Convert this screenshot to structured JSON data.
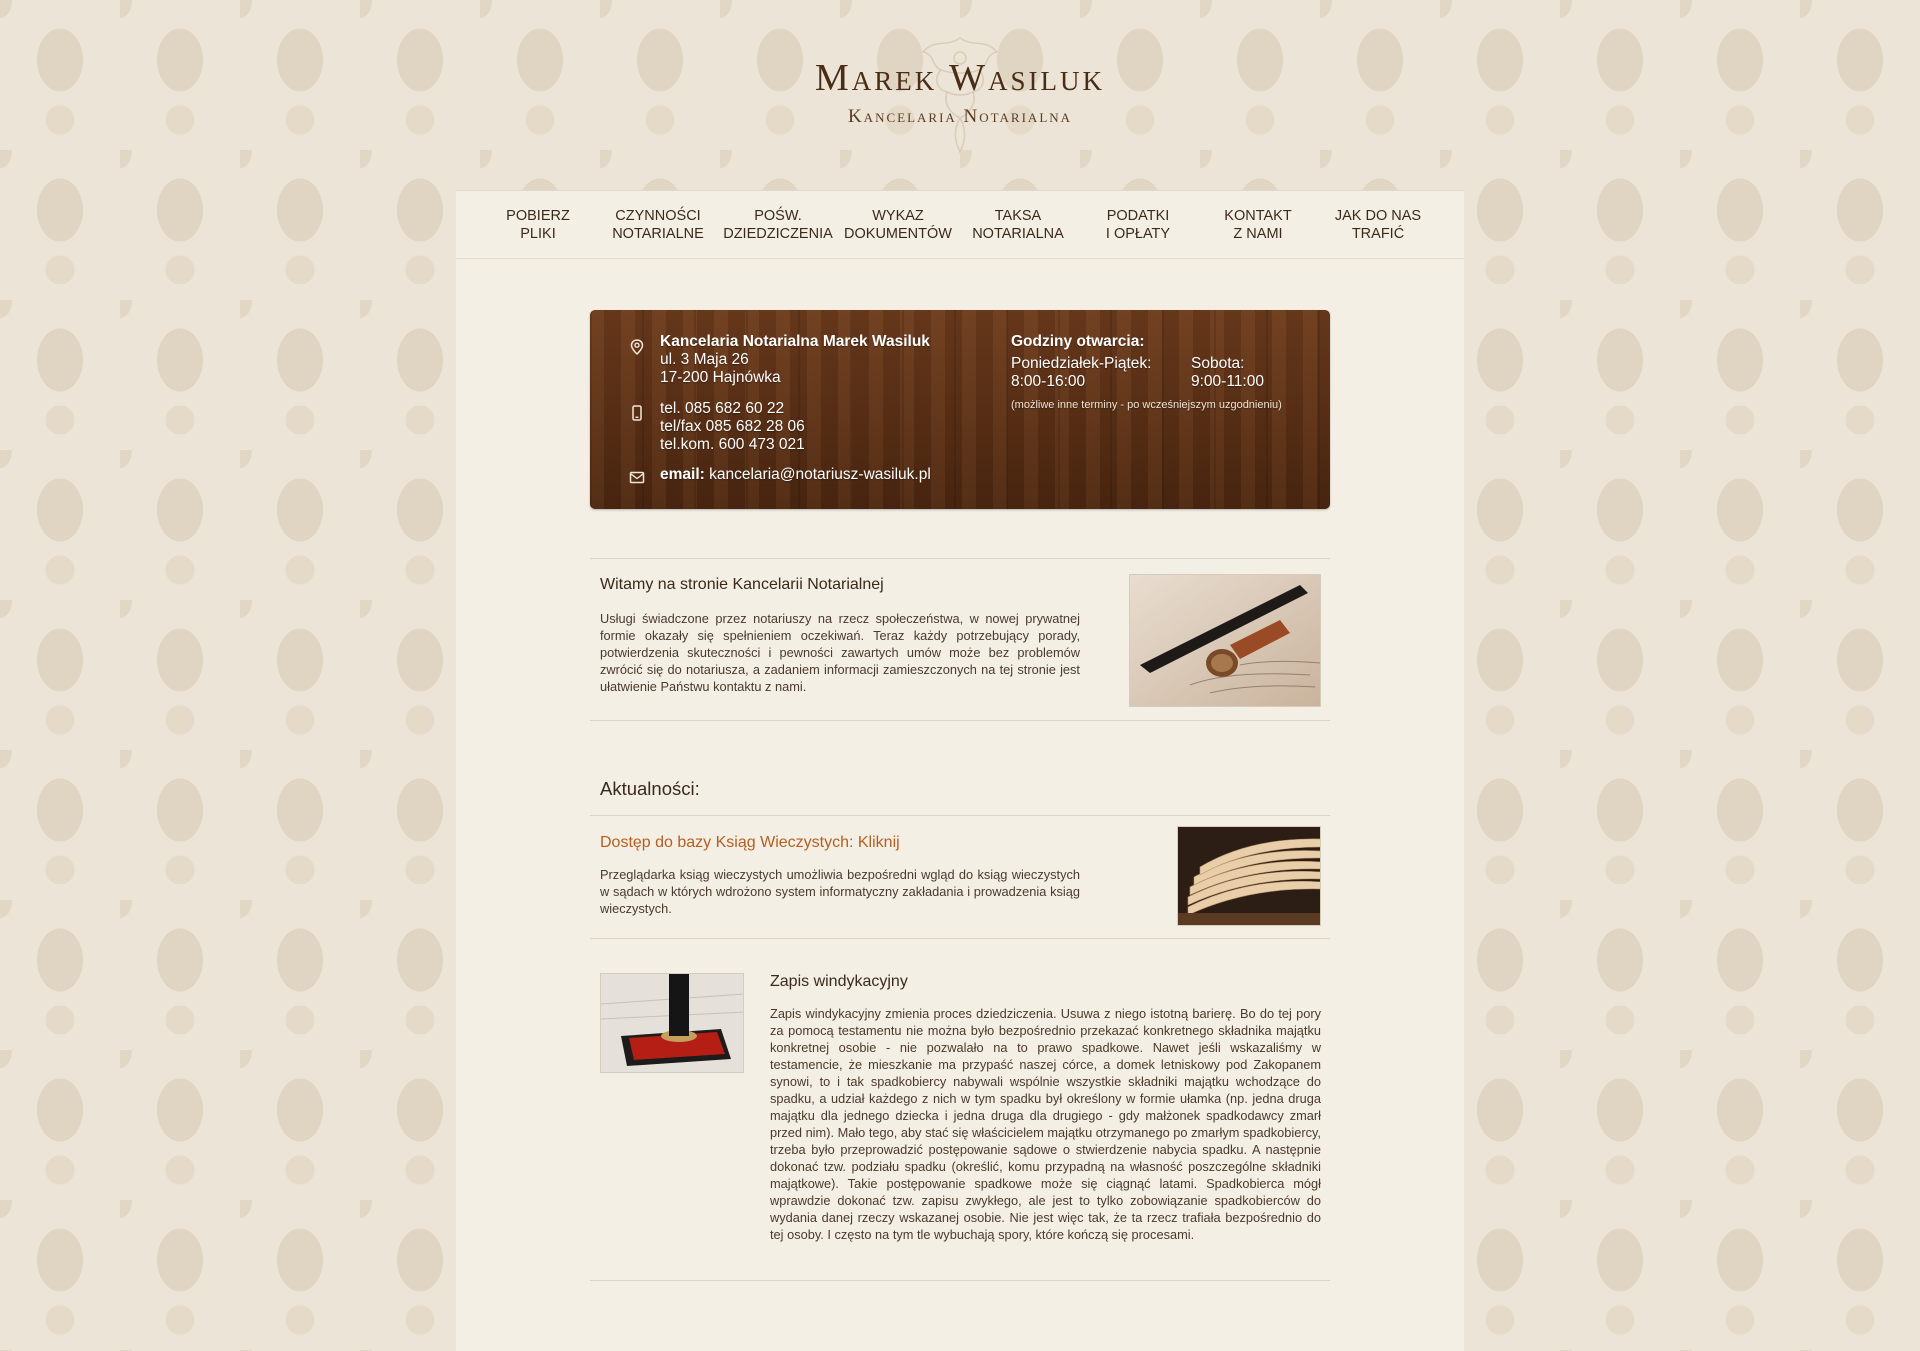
{
  "header": {
    "title": "Marek Wasiluk",
    "subtitle": "Kancelaria Notarialna"
  },
  "nav": {
    "items": [
      {
        "label": "POBIERZ\nPLIKI"
      },
      {
        "label": "CZYNNOŚCI\nNOTARIALNE"
      },
      {
        "label": "POŚW.\nDZIEDZICZENIA"
      },
      {
        "label": "WYKAZ\nDOKUMENTÓW"
      },
      {
        "label": "TAKSA\nNOTARIALNA"
      },
      {
        "label": "PODATKI\nI OPŁATY"
      },
      {
        "label": "KONTAKT\nZ NAMI"
      },
      {
        "label": "JAK DO NAS\nTRAFIĆ"
      }
    ]
  },
  "contact": {
    "office_name": "Kancelaria Notarialna Marek Wasiluk",
    "address": "ul. 3 Maja 26\n17-200 Hajnówka",
    "phones": "tel. 085 682 60 22\ntel/fax 085 682 28 06\ntel.kom. 600 473 021",
    "email_label": "email:",
    "email": "kancelaria@notariusz-wasiluk.pl",
    "hours_title": "Godziny otwarcia:",
    "weekdays_label": "Poniedziałek-Piątek:",
    "weekdays_hours": "8:00-16:00",
    "saturday_label": "Sobota:",
    "saturday_hours": "9:00-11:00",
    "hours_note": "(możliwe inne terminy - po wcześniejszym uzgodnieniu)",
    "icons": [
      "map-pin-icon",
      "phone-icon",
      "mail-icon"
    ]
  },
  "welcome": {
    "title": "Witamy na stronie Kancelarii Notarialnej",
    "text": "Usługi świadczone przez notariuszy na rzecz społeczeństwa, w nowej prywatnej formie okazały się spełnieniem oczekiwań. Teraz każdy potrzebujący porady, potwierdzenia skuteczności i pewności zawartych umów może bez problemów zwrócić się do notariusza, a zadaniem informacji zamieszczonych na tej stronie jest ułatwienie Państwu kontaktu z nami."
  },
  "news": {
    "title": "Aktualności:",
    "items": [
      {
        "title": "Dostęp do bazy Ksiąg Wieczystych: Kliknij",
        "text": "Przeglądarka ksiąg wieczystych umożliwia bezpośredni wgląd do ksiąg wieczystych w sądach w których wdrożono system informatyczny zakładania i prowadzenia ksiąg wieczystych."
      },
      {
        "title": "Zapis windykacyjny",
        "text": "Zapis windykacyjny zmienia proces dziedziczenia. Usuwa z niego istotną barierę. Bo do tej pory za pomocą testamentu nie można było bezpośrednio przekazać konkretnego składnika majątku konkretnej osobie - nie pozwalało na to prawo spadkowe. Nawet jeśli wskazaliśmy w testamencie, że mieszkanie ma przypaść naszej córce, a domek letniskowy pod Zakopanem synowi, to i tak spadkobiercy nabywali wspólnie wszystkie składniki majątku wchodzące do spadku, a udział każdego z nich w tym spadku był określony w formie ułamka (np. jedna druga majątku dla jednego dziecka i jedna druga dla drugiego - gdy małżonek spadkodawcy zmarł przed nim). Mało tego, aby stać się właścicielem majątku otrzymanego po zmarłym spadkobiercy, trzeba było przeprowadzić postępowanie sądowe o stwierdzenie nabycia spadku. A następnie dokonać tzw. podziału spadku (określić, komu przypadną na własność poszczególne składniki majątkowe). Takie postępowanie spadkowe może się ciągnąć latami. Spadkobierca mógł wprawdzie dokonać tzw. zapisu zwykłego, ale jest to tylko zobowiązanie spadkobierców do wydania danej rzeczy wskazanej osobie. Nie jest więc tak, że ta rzecz trafiała bezpośrednio do tej osoby. I często na tym tle wybuchają spory, które kończą się procesami."
      }
    ]
  },
  "colors": {
    "wood": "#5a2f15",
    "accent_link": "#b45f1f",
    "page_bg": "#f4efe5"
  }
}
